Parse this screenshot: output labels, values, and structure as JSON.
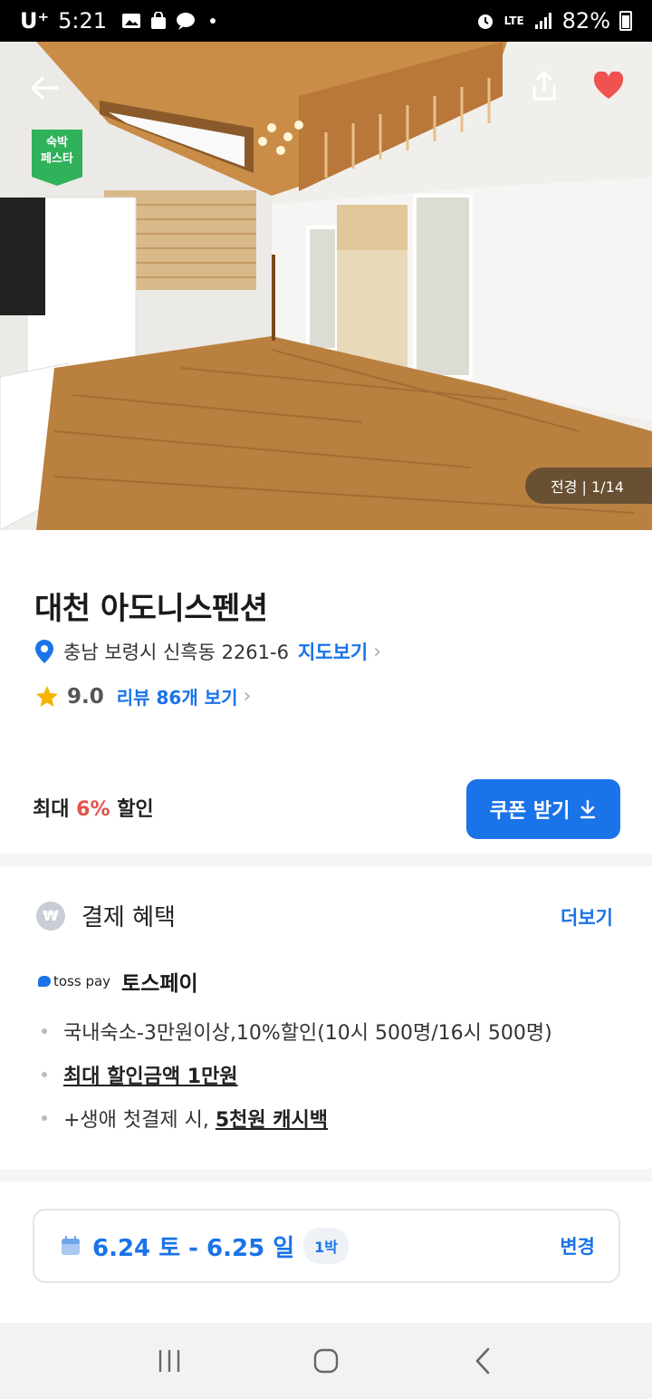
{
  "status_bar": {
    "carrier": "U⁺",
    "time": "5:21",
    "network": "LTE",
    "battery": "82%"
  },
  "hero": {
    "badge_line1": "숙박",
    "badge_line2": "페스타",
    "photo_counter": "전경 | 1/14",
    "heart_color": "#f0524f"
  },
  "property": {
    "name": "대천 아도니스펜션",
    "address": "충남 보령시 신흑동 2261-6",
    "map_link": "지도보기",
    "rating": "9.0",
    "review_link": "리뷰 86개 보기"
  },
  "discount": {
    "prefix": "최대",
    "percent": "6%",
    "suffix": "할인",
    "coupon_button": "쿠폰 받기"
  },
  "payment": {
    "title": "결제 혜택",
    "more": "더보기",
    "won_symbol": "₩",
    "provider_logo": "toss pay",
    "provider_name": "토스페이",
    "benefits": [
      "국내숙소-3만원이상,10%할인(10시 500명/16시 500명)",
      "최대 할인금액 1만원",
      "+생애 첫결제 시, ",
      "5천원 캐시백"
    ]
  },
  "booking": {
    "dates": "6.24 토 - 6.25 일",
    "nights": "1박",
    "change": "변경"
  },
  "colors": {
    "accent": "#1a73e8",
    "discount": "#e5534b",
    "badge": "#2fb25a"
  }
}
